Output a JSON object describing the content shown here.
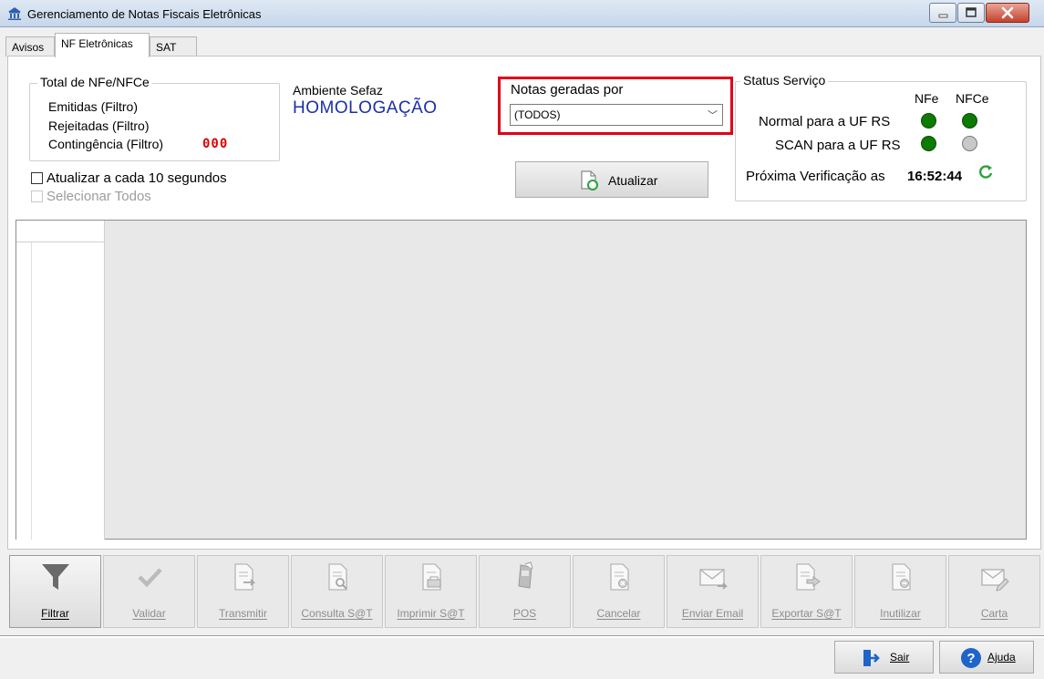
{
  "window": {
    "title": "Gerenciamento de Notas Fiscais Eletrônicas"
  },
  "tabs": [
    {
      "label": "Avisos"
    },
    {
      "label": "NF Eletrônicas",
      "active": true
    },
    {
      "label": "SAT"
    }
  ],
  "totals": {
    "title": "Total de NFe/NFCe",
    "emitidas": "Emitidas (Filtro)",
    "rejeitadas": "Rejeitadas (Filtro)",
    "contingencia": "Contingência (Filtro)",
    "contingencia_count": "000"
  },
  "ambiente": {
    "label": "Ambiente Sefaz",
    "value": "HOMOLOGAÇÃO"
  },
  "notas_geradas": {
    "label": "Notas geradas por",
    "selected": "(TODOS)"
  },
  "options": {
    "auto_refresh": {
      "label": "Atualizar a cada 10 segundos",
      "checked": false
    },
    "select_all": {
      "label": "Selecionar Todos",
      "checked": false,
      "disabled": true
    }
  },
  "refresh_button": {
    "label": "Atualizar"
  },
  "status": {
    "title": "Status Serviço",
    "col_nfe": "NFe",
    "col_nfce": "NFCe",
    "rows": [
      {
        "label": "Normal para a UF RS",
        "nfe": "online",
        "nfce": "online"
      },
      {
        "label": "SCAN para a UF RS",
        "nfe": "online",
        "nfce": "offline"
      }
    ],
    "next_check_label": "Próxima Verificação as",
    "next_check_time": "16:52:44"
  },
  "toolbar": [
    {
      "label": "Filtrar",
      "icon": "filter-icon",
      "enabled": true
    },
    {
      "label": "Validar",
      "icon": "check-icon",
      "enabled": false
    },
    {
      "label": "Transmitir",
      "icon": "document-send-icon",
      "enabled": false
    },
    {
      "label": "Consulta S@T",
      "icon": "document-search-icon",
      "enabled": false
    },
    {
      "label": "Imprimir S@T",
      "icon": "document-print-icon",
      "enabled": false
    },
    {
      "label": "POS",
      "icon": "pos-terminal-icon",
      "enabled": false
    },
    {
      "label": "Cancelar",
      "icon": "document-cancel-icon",
      "enabled": false
    },
    {
      "label": "Enviar Email",
      "icon": "envelope-send-icon",
      "enabled": false
    },
    {
      "label": "Exportar S@T",
      "icon": "document-export-icon",
      "enabled": false
    },
    {
      "label": "Inutilizar",
      "icon": "document-disable-icon",
      "enabled": false
    },
    {
      "label": "Carta",
      "icon": "letter-edit-icon",
      "enabled": false
    }
  ],
  "footer": {
    "exit_label": "Sair",
    "help_label": "Ajuda"
  },
  "colors": {
    "status_online": "#0d7b00",
    "status_offline": "#c8c8c8",
    "highlight": "#e0001a",
    "environment": "#1a2fa8",
    "count_red": "#e00000"
  }
}
